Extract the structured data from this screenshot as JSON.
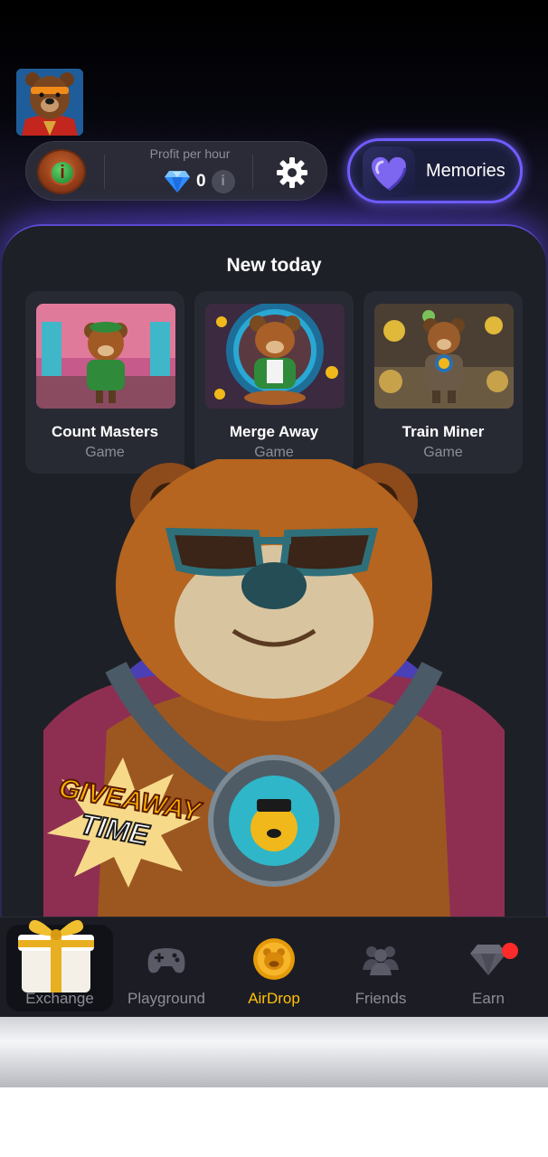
{
  "header": {
    "profit_label": "Profit per hour",
    "profit_value": "0",
    "info_glyph": "i",
    "memories_label": "Memories"
  },
  "new_today": {
    "title": "New today",
    "games": [
      {
        "title": "Count Masters",
        "type": "Game"
      },
      {
        "title": "Merge Away",
        "type": "Game"
      },
      {
        "title": "Train Miner",
        "type": "Game"
      }
    ]
  },
  "banner": {
    "giveaway_line1": "GIVEAWAY",
    "giveaway_line2": "TIME"
  },
  "nav": {
    "items": [
      {
        "label": "Exchange",
        "icon": "gift-icon",
        "active": true
      },
      {
        "label": "Playground",
        "icon": "gamepad-icon"
      },
      {
        "label": "AirDrop",
        "icon": "coin-icon"
      },
      {
        "label": "Friends",
        "icon": "friends-icon"
      },
      {
        "label": "Earn",
        "icon": "diamond-icon",
        "notification": true
      }
    ]
  },
  "colors": {
    "accent": "#6f5dff",
    "airdrop": "#ffc107",
    "notification": "#ff2a2a"
  }
}
